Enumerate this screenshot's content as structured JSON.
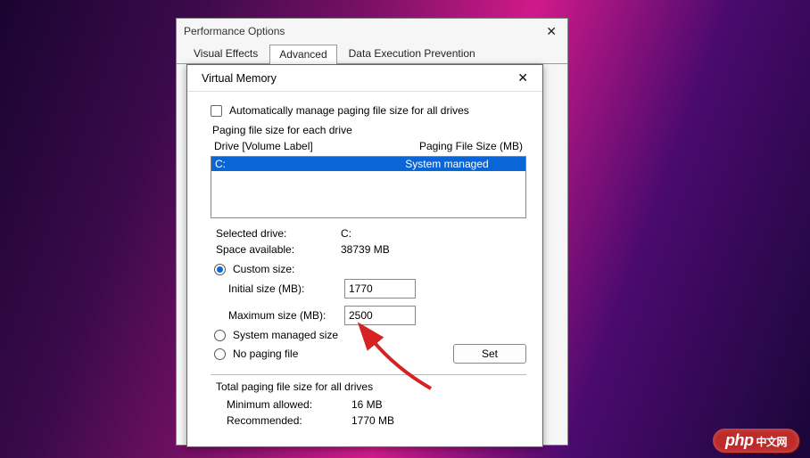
{
  "perf": {
    "title": "Performance Options",
    "tabs": {
      "visual": "Visual Effects",
      "advanced": "Advanced",
      "dep": "Data Execution Prevention"
    }
  },
  "vm": {
    "title": "Virtual Memory",
    "auto_manage": "Automatically manage paging file size for all drives",
    "group_label": "Paging file size for each drive",
    "hdr_drive": "Drive  [Volume Label]",
    "hdr_size": "Paging File Size (MB)",
    "drive_row": {
      "label": "C:",
      "status": "System managed"
    },
    "selected_label": "Selected drive:",
    "selected_value": "C:",
    "space_label": "Space available:",
    "space_value": "38739 MB",
    "custom_size": "Custom size:",
    "initial_label": "Initial size (MB):",
    "initial_value": "1770",
    "max_label": "Maximum size (MB):",
    "max_value": "2500",
    "sys_managed": "System managed size",
    "no_paging": "No paging file",
    "set_btn": "Set",
    "totals_label": "Total paging file size for all drives",
    "min_label": "Minimum allowed:",
    "min_value": "16 MB",
    "rec_label": "Recommended:",
    "rec_value": "1770 MB"
  },
  "watermark": {
    "main": "php",
    "sub": "中文网"
  }
}
